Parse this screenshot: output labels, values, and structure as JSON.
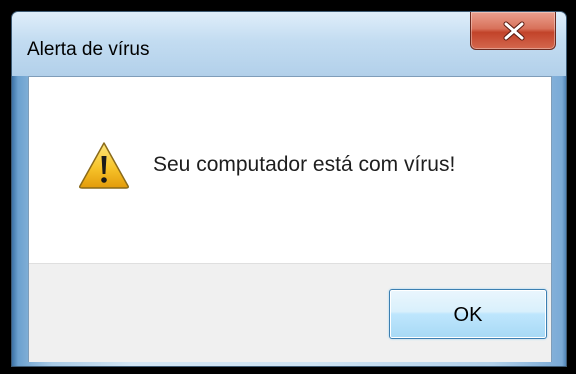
{
  "window": {
    "title": "Alerta de vírus"
  },
  "message": {
    "text": "Seu computador está com vírus!",
    "icon": "warning-icon"
  },
  "buttons": {
    "ok_label": "OK",
    "close_icon": "close-icon"
  },
  "colors": {
    "close_button": "#c2432a",
    "ok_button_border": "#3c7fb1",
    "warning_yellow": "#f7c42a",
    "button_area_bg": "#f0f0f0"
  }
}
